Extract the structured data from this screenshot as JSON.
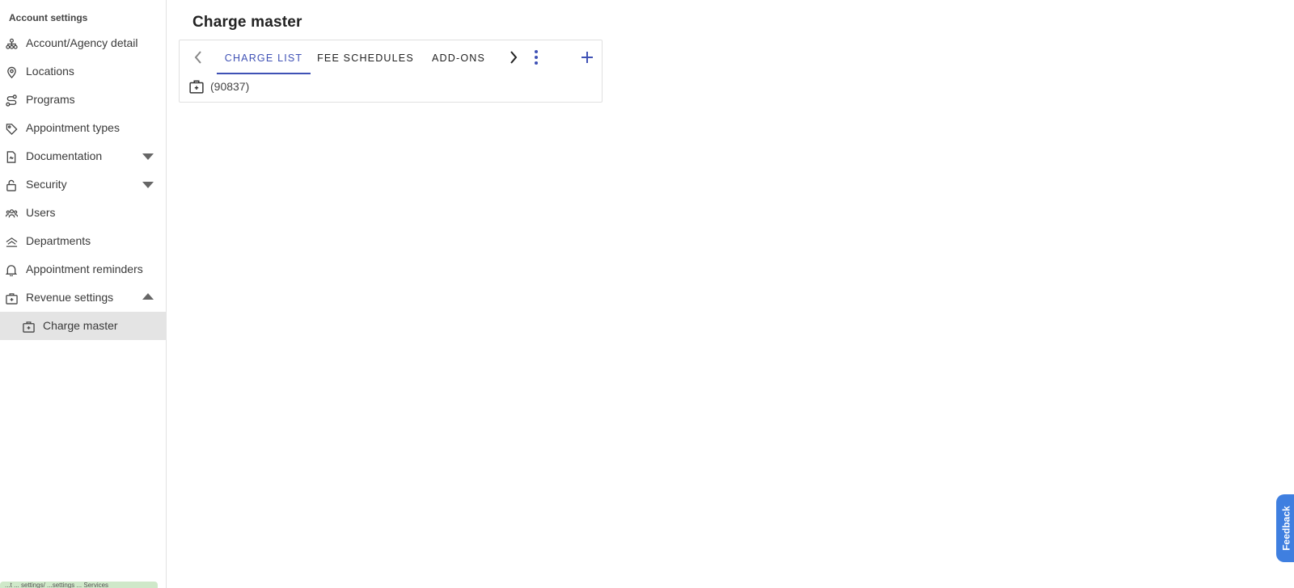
{
  "sidebar": {
    "heading": "Account settings",
    "items": [
      {
        "label": "Account/Agency detail",
        "icon": "hierarchy-icon"
      },
      {
        "label": "Locations",
        "icon": "map-pin-icon"
      },
      {
        "label": "Programs",
        "icon": "route-icon"
      },
      {
        "label": "Appointment types",
        "icon": "tag-icon"
      },
      {
        "label": "Documentation",
        "icon": "document-icon",
        "expandable": true,
        "expanded": false
      },
      {
        "label": "Security",
        "icon": "lock-icon",
        "expandable": true,
        "expanded": false
      },
      {
        "label": "Users",
        "icon": "users-icon"
      },
      {
        "label": "Departments",
        "icon": "departments-icon"
      },
      {
        "label": "Appointment reminders",
        "icon": "bell-icon"
      },
      {
        "label": "Revenue settings",
        "icon": "medical-briefcase-icon",
        "expandable": true,
        "expanded": true
      }
    ],
    "subitems": [
      {
        "label": "Charge master",
        "icon": "medical-briefcase-icon",
        "selected": true
      }
    ],
    "bottom_strip_text": "...t ... settings/ ...settings ... Services"
  },
  "main": {
    "title": "Charge master",
    "tabs": [
      {
        "label": "CHARGE LIST",
        "active": true
      },
      {
        "label": "FEE SCHEDULES",
        "active": false
      },
      {
        "label": "ADD-ONS",
        "active": false
      }
    ],
    "rows": [
      {
        "label": "(90837)",
        "icon": "medical-briefcase-icon"
      }
    ]
  },
  "feedback": {
    "label": "Feedback"
  },
  "colors": {
    "accent": "#3f51b5",
    "feedback": "#3f7fe0",
    "selected_bg": "#e4e4e4"
  }
}
